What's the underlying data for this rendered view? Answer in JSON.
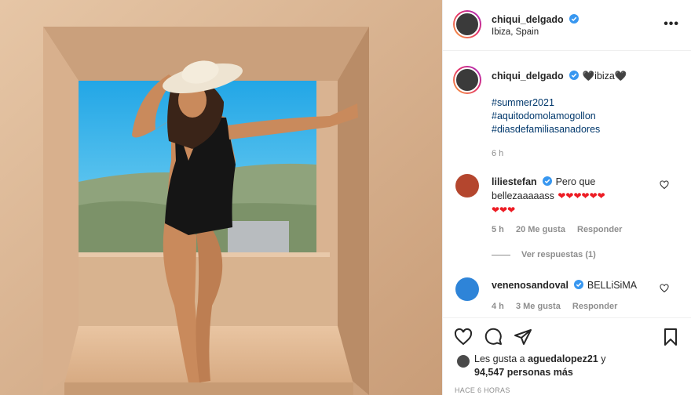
{
  "post": {
    "author": "chiqui_delgado",
    "location": "Ibiza, Spain",
    "more_label": "•••"
  },
  "caption": {
    "username": "chiqui_delgado",
    "text_prefix": "🖤",
    "text_main": "ibiza",
    "text_suffix": "🖤",
    "hashtags": [
      "#summer2021",
      "#aquitodomolamogollon",
      "#diasdefamiliasanadores"
    ],
    "time": "6 h"
  },
  "comments": [
    {
      "username": "liliestefan",
      "text_line1": "Pero que",
      "text_line2": "bellezaaaaass",
      "hearts_line2": "❤❤❤❤❤❤",
      "hearts_line3": "❤❤❤",
      "time": "5 h",
      "likes": "20 Me gusta",
      "reply": "Responder",
      "view_replies": "Ver respuestas (1)"
    },
    {
      "username": "venenosandoval",
      "text": "BELLiSiMA",
      "time": "4 h",
      "likes": "3 Me gusta",
      "reply": "Responder"
    }
  ],
  "likes": {
    "prefix": "Les gusta a",
    "liker": "aguedalopez21",
    "connector": "y",
    "count": "94,547 personas más"
  },
  "posted_ago": "HACE 6 HORAS",
  "colors": {
    "verified": "#3897f0",
    "link": "#00376b",
    "muted": "#8e8e8e",
    "heart": "#ed1c24"
  }
}
